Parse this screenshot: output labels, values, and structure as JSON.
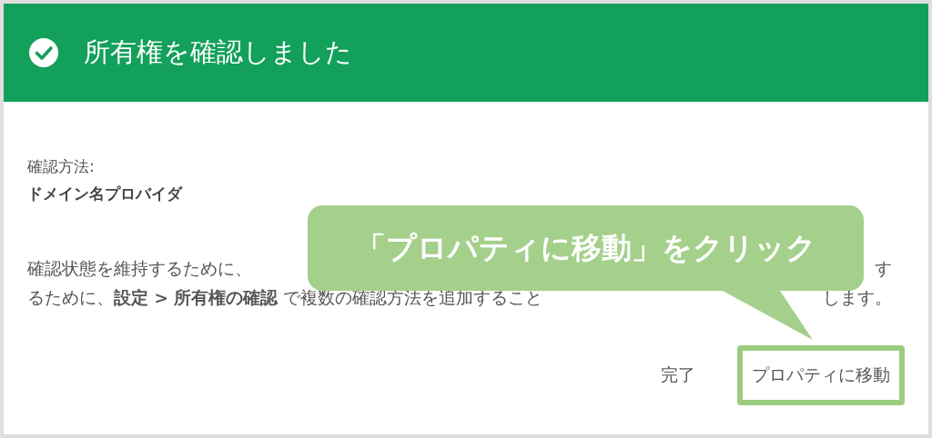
{
  "dialog": {
    "title": "所有権を確認しました",
    "method_label": "確認方法:",
    "method_value": "ドメイン名プロバイダ",
    "paragraph_lines": [
      {
        "left": "確認状態を維持するために、",
        "right": "す"
      },
      {
        "left": "るために、**設定 > 所有権の確認** で複数の確認方法を追加すること",
        "right": "します。"
      }
    ],
    "buttons": [
      {
        "label": "完了",
        "highlighted": false
      },
      {
        "label": "プロパティに移動",
        "highlighted": true
      }
    ]
  },
  "callout": {
    "text": "「プロパティに移動」をクリック"
  }
}
